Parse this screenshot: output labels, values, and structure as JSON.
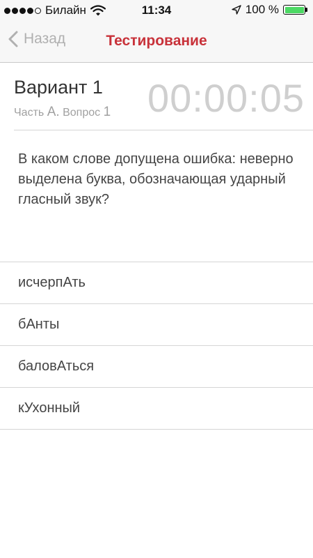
{
  "status_bar": {
    "carrier": "Билайн",
    "time": "11:34",
    "battery": "100 %",
    "signal_strength": 4,
    "signal_max": 5,
    "battery_level": 1.0,
    "battery_color": "#4cd964",
    "icons": [
      "wifi-icon",
      "location-arrow-icon",
      "battery-icon"
    ]
  },
  "nav": {
    "back_label": "Назад",
    "title": "Тестирование",
    "title_color": "#c8323a"
  },
  "variant": {
    "title": "Вариант 1",
    "part_prefix": "Часть",
    "part_letter": "А.",
    "question_label": "Вопрос",
    "question_number": "1",
    "timer": "00:00:05"
  },
  "question": {
    "text": "В каком слове допущена ошибка: неверно выделена буква, обозначающая ударный гласный звук?"
  },
  "answers": [
    {
      "label": "исчерпАть"
    },
    {
      "label": "бАнты"
    },
    {
      "label": "баловАться"
    },
    {
      "label": "кУхонный"
    }
  ]
}
